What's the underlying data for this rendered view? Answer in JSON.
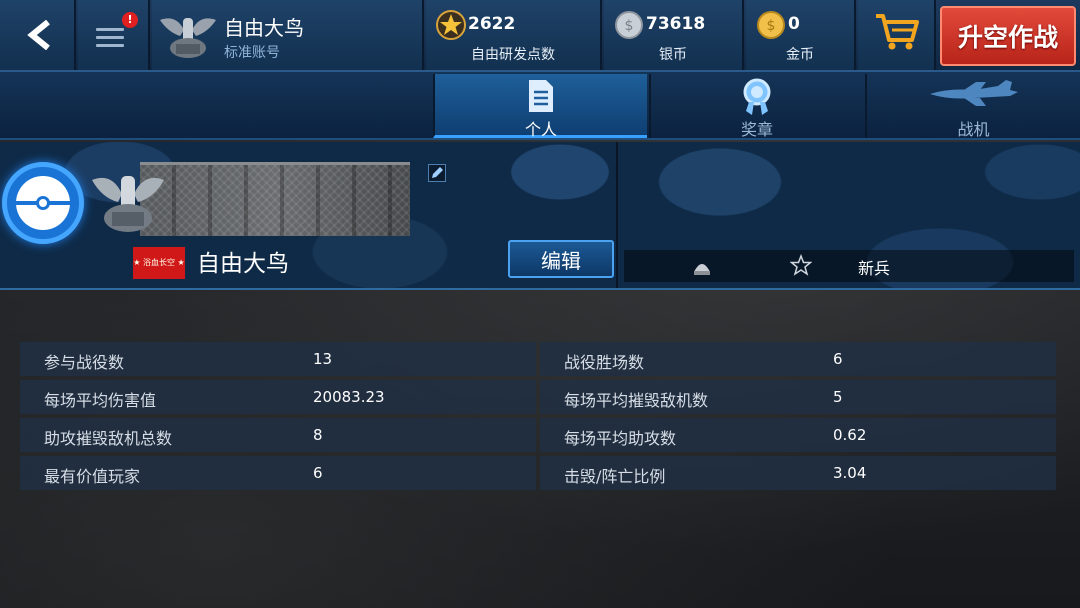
{
  "header": {
    "player_name": "自由大鸟",
    "account_type": "标准账号",
    "notification_badge": "!",
    "resources": [
      {
        "icon": "star-icon",
        "value": "2622",
        "label": "自由研发点数"
      },
      {
        "icon": "silver-coin-icon",
        "value": "73618",
        "label": "银币"
      },
      {
        "icon": "gold-coin-icon",
        "value": "0",
        "label": "金币"
      }
    ],
    "takeoff_label": "升空作战"
  },
  "tabs": [
    {
      "label": "个人",
      "icon": "document-icon",
      "active": true
    },
    {
      "label": "奖章",
      "icon": "medal-icon",
      "active": false
    },
    {
      "label": "战机",
      "icon": "airplane-icon",
      "active": false
    }
  ],
  "profile": {
    "name": "自由大鸟",
    "flag_text": "★ 浴血长空 ★",
    "edit_label": "编辑",
    "rank_label": "新兵"
  },
  "stats": [
    {
      "left_label": "参与战役数",
      "left_value": "13",
      "right_label": "战役胜场数",
      "right_value": "6"
    },
    {
      "left_label": "每场平均伤害值",
      "left_value": "20083.23",
      "right_label": "每场平均摧毁敌机数",
      "right_value": "5"
    },
    {
      "left_label": "助攻摧毁敌机总数",
      "left_value": "8",
      "right_label": "每场平均助攻数",
      "right_value": "0.62"
    },
    {
      "left_label": "最有价值玩家",
      "left_value": "6",
      "right_label": "击毁/阵亡比例",
      "right_value": "3.04"
    }
  ],
  "colors": {
    "accent_blue": "#3aa0ff",
    "takeoff_red": "#d8382a",
    "panel_bg": "#0f2a47"
  }
}
